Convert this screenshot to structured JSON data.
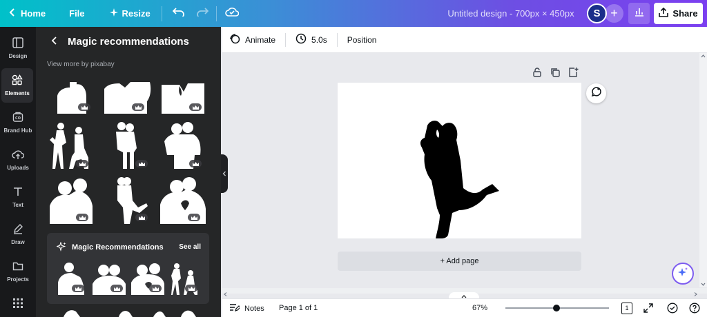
{
  "topbar": {
    "home_label": "Home",
    "file_label": "File",
    "resize_label": "Resize",
    "title": "Untitled design - 700px × 450px",
    "avatar_initial": "S",
    "share_label": "Share"
  },
  "rail": {
    "items": [
      {
        "label": "Design",
        "icon": "layout-icon"
      },
      {
        "label": "Elements",
        "icon": "shapes-icon"
      },
      {
        "label": "Brand Hub",
        "icon": "brand-icon"
      },
      {
        "label": "Uploads",
        "icon": "cloud-upload-icon"
      },
      {
        "label": "Text",
        "icon": "text-icon"
      },
      {
        "label": "Draw",
        "icon": "pen-icon"
      },
      {
        "label": "Projects",
        "icon": "folder-icon"
      },
      {
        "label": "Apps",
        "icon": "apps-icon"
      }
    ]
  },
  "panel": {
    "heading": "Magic recommendations",
    "subtitle": "View more by pixabay",
    "magic_title": "Magic Recommendations",
    "see_all": "See all"
  },
  "toolbar2": {
    "animate_label": "Animate",
    "duration_label": "5.0s",
    "position_label": "Position"
  },
  "canvas": {
    "add_page_label": "+ Add page"
  },
  "bottom": {
    "notes_label": "Notes",
    "page_label": "Page 1 of 1",
    "zoom_label": "67%",
    "zoom_fraction": 0.49,
    "page_count": "1"
  },
  "colors": {
    "accent": "#7d2ae8",
    "dark_panel": "#252627",
    "rail": "#18191b"
  }
}
